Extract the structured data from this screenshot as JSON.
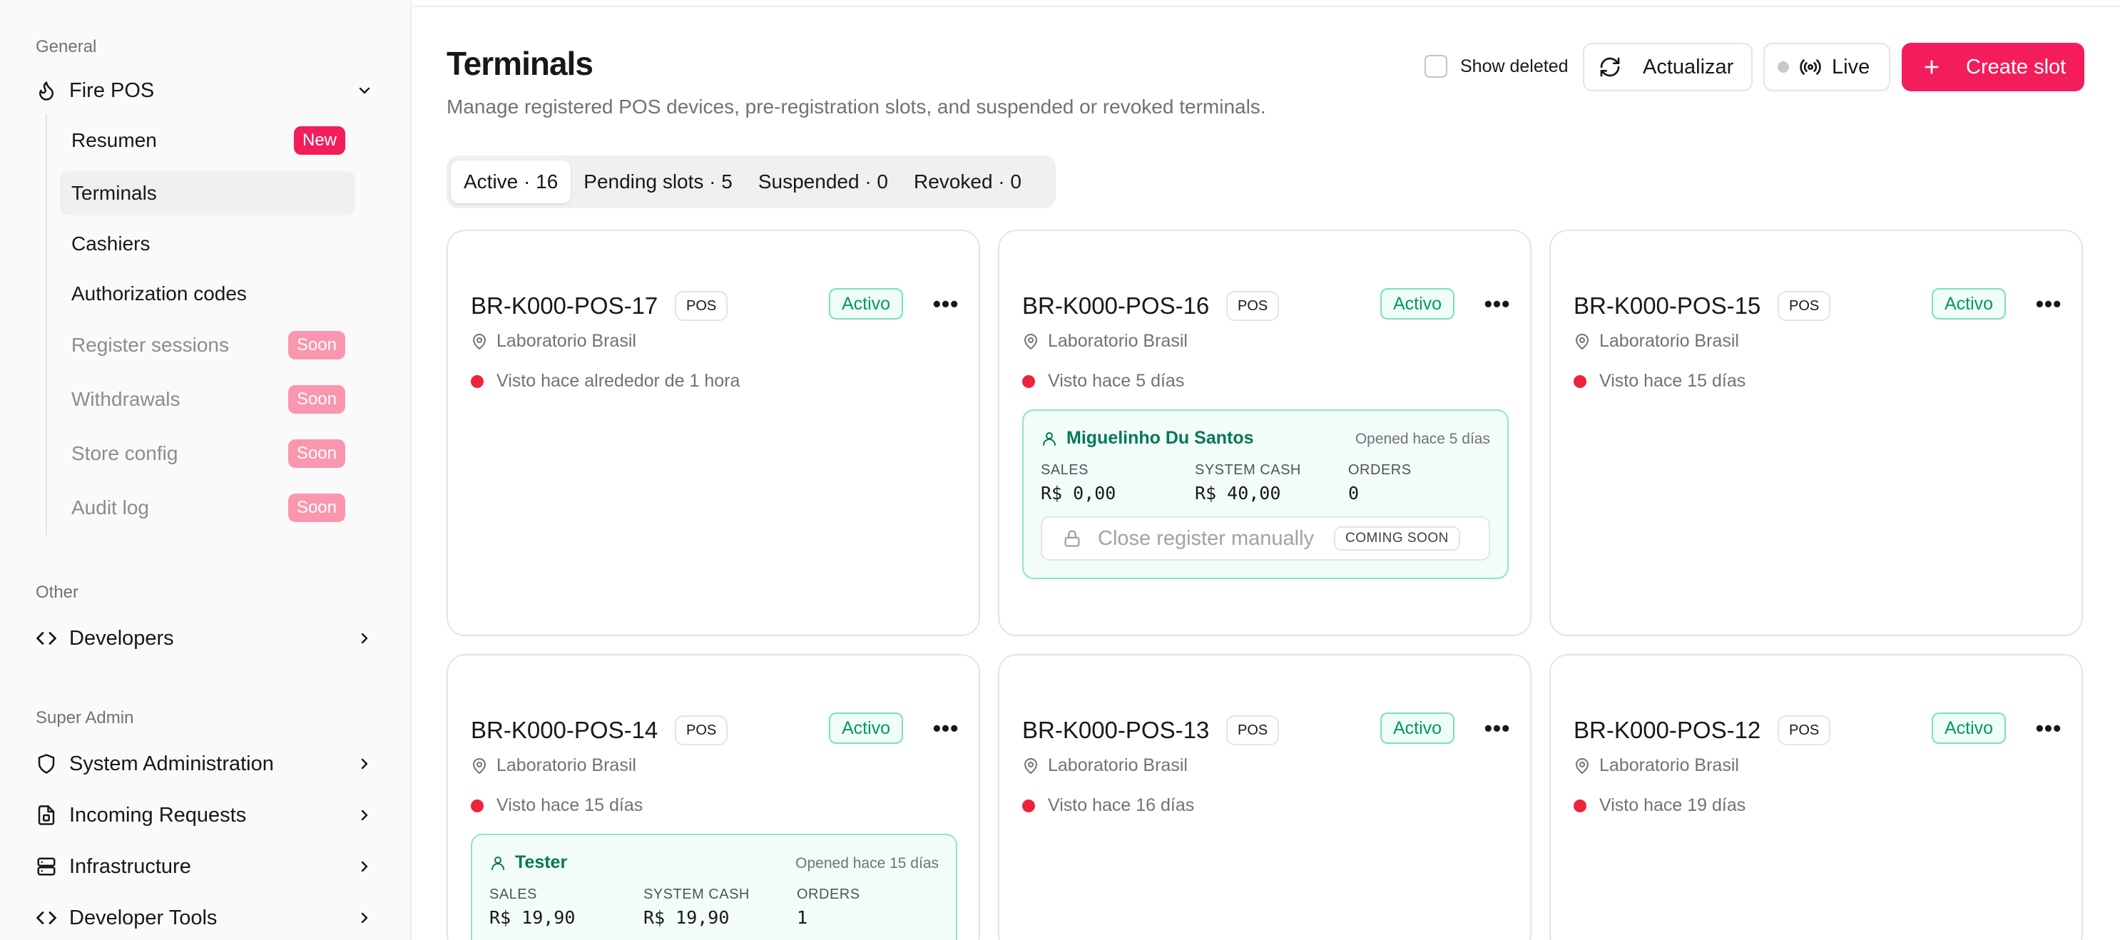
{
  "sidebar": {
    "sections": {
      "general": "General",
      "other": "Other",
      "super_admin": "Super Admin"
    },
    "fire_pos": {
      "label": "Fire POS",
      "icon": "flame-icon"
    },
    "sub_items": [
      {
        "label": "Resumen",
        "badge": "New"
      },
      {
        "label": "Terminals",
        "badge": ""
      },
      {
        "label": "Cashiers",
        "badge": ""
      },
      {
        "label": "Authorization codes",
        "badge": ""
      },
      {
        "label": "Register sessions",
        "badge": "Soon"
      },
      {
        "label": "Withdrawals",
        "badge": "Soon"
      },
      {
        "label": "Store config",
        "badge": "Soon"
      },
      {
        "label": "Audit log",
        "badge": "Soon"
      }
    ],
    "other_items": [
      {
        "label": "Developers",
        "icon": "code-icon"
      }
    ],
    "admin_items": [
      {
        "label": "System Administration",
        "icon": "shield-icon"
      },
      {
        "label": "Incoming Requests",
        "icon": "document-icon"
      },
      {
        "label": "Infrastructure",
        "icon": "server-icon"
      },
      {
        "label": "Developer Tools",
        "icon": "code-icon"
      }
    ]
  },
  "header": {
    "title": "Terminals",
    "subtitle": "Manage registered POS devices, pre-registration slots, and suspended or revoked terminals.",
    "show_deleted": "Show deleted",
    "refresh": "Actualizar",
    "live": "Live",
    "create": "Create slot"
  },
  "tabs": [
    {
      "label": "Active · 16",
      "active": true
    },
    {
      "label": "Pending slots · 5",
      "active": false
    },
    {
      "label": "Suspended · 0",
      "active": false
    },
    {
      "label": "Revoked · 0",
      "active": false
    }
  ],
  "terminals": [
    {
      "name": "BR-K000-POS-17",
      "type": "POS",
      "status": "Activo",
      "location": "Laboratorio Brasil",
      "seen": "Visto hace alrededor de 1 hora"
    },
    {
      "name": "BR-K000-POS-16",
      "type": "POS",
      "status": "Activo",
      "location": "Laboratorio Brasil",
      "seen": "Visto hace 5 días"
    },
    {
      "name": "BR-K000-POS-15",
      "type": "POS",
      "status": "Activo",
      "location": "Laboratorio Brasil",
      "seen": "Visto hace 15 días"
    },
    {
      "name": "BR-K000-POS-14",
      "type": "POS",
      "status": "Activo",
      "location": "Laboratorio Brasil",
      "seen": "Visto hace 15 días"
    },
    {
      "name": "BR-K000-POS-13",
      "type": "POS",
      "status": "Activo",
      "location": "Laboratorio Brasil",
      "seen": "Visto hace 16 días"
    },
    {
      "name": "BR-K000-POS-12",
      "type": "POS",
      "status": "Activo",
      "location": "Laboratorio Brasil",
      "seen": "Visto hace 19 días"
    }
  ],
  "sessions": {
    "pos16": {
      "cashier": "Miguelinho Du Santos",
      "opened": "Opened hace 5 días",
      "sales_label": "SALES",
      "sales": "R$ 0,00",
      "cash_label": "SYSTEM CASH",
      "cash": "R$ 40,00",
      "orders_label": "ORDERS",
      "orders": "0",
      "close_label": "Close register manually",
      "coming_soon": "COMING SOON"
    },
    "pos14": {
      "cashier": "Tester",
      "opened": "Opened hace 15 días",
      "sales_label": "SALES",
      "sales": "R$ 19,90",
      "cash_label": "SYSTEM CASH",
      "cash": "R$ 19,90",
      "orders_label": "ORDERS",
      "orders": "1"
    }
  },
  "colors": {
    "brand": "#f31d5b",
    "active_green": "#059669",
    "offline_red": "#ef233c"
  }
}
